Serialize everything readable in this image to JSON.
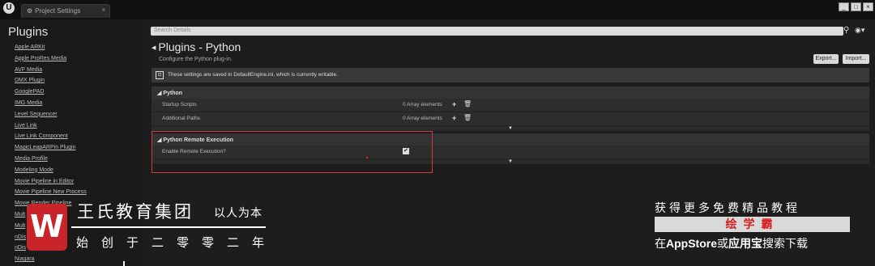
{
  "window": {
    "tab_title": "Project Settings",
    "tab_icon": "gear-icon",
    "close_glyph": "×",
    "controls": [
      "_",
      "□",
      "×"
    ]
  },
  "sidebar": {
    "heading": "Plugins",
    "items": [
      "Apple ARKit",
      "Apple ProRes Media",
      "AVF Media",
      "DMX Plugin",
      "GooglePAD",
      "IMG Media",
      "Level Sequencer",
      "Live Link",
      "Live Link Component",
      "MagicLeapARPin Plugin",
      "Media Profile",
      "Modeling Mode",
      "Movie Pipeline in Editor",
      "Movie Pipeline New Process",
      "Movie Render Pipeline",
      "Mult",
      "Mult",
      "nDis",
      "nDis",
      "Niagara"
    ]
  },
  "main": {
    "search_placeholder": "Search Details",
    "title": "Plugins - Python",
    "description": "Configure the Python plug-in.",
    "export_label": "Export...",
    "import_label": "Import...",
    "notice": "These settings are saved in DefaultEngine.ini, which is currently writable.",
    "sections": {
      "python": {
        "title": "Python",
        "rows": [
          {
            "label": "Startup Scripts",
            "value": "0 Array elements"
          },
          {
            "label": "Additional Paths",
            "value": "0 Array elements"
          }
        ]
      },
      "remote": {
        "title": "Python Remote Execution",
        "row_label": "Enable Remote Execution?",
        "checked": true
      }
    }
  },
  "watermark": {
    "logo_letter": "W",
    "name": "王氏教育集团",
    "slogan": "以人为本",
    "year": "始创于二零零二年"
  },
  "promo": {
    "top": "获得更多免费精品教程",
    "middle": "绘学霸",
    "bottom_prefix": "在",
    "bottom_app": "AppStore",
    "bottom_mid": "或",
    "bottom_store": "应用宝",
    "bottom_suffix": "搜索下载"
  },
  "colors": {
    "highlight_box": "#d23b3b",
    "logo_red": "#c8242a",
    "promo_red": "#d42020"
  }
}
